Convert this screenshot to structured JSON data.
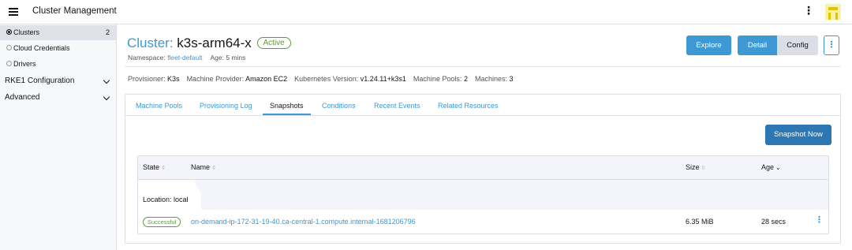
{
  "header": {
    "app_title": "Cluster Management",
    "menu_icon": "hamburger-menu-icon",
    "more_icon": "vertical-dots-icon",
    "logo_icon": "rancher-logo"
  },
  "sidebar": {
    "items": [
      {
        "label": "Clusters",
        "count": "2",
        "icon": "cluster-icon",
        "active": true
      },
      {
        "label": "Cloud Credentials",
        "icon": "circle-icon"
      },
      {
        "label": "Drivers",
        "icon": "circle-icon"
      }
    ],
    "groups": [
      {
        "label": "RKE1 Configuration"
      },
      {
        "label": "Advanced"
      }
    ]
  },
  "cluster": {
    "prefix": "Cluster: ",
    "name": "k3s-arm64-x",
    "state": "Active",
    "namespace_label": "Namespace: ",
    "namespace": "fleet-default",
    "age": "Age: 5 mins",
    "provisioner_label": "Provisioner:",
    "provisioner": "K3s",
    "machine_provider_label": "Machine Provider:",
    "machine_provider": "Amazon EC2",
    "k8s_version_label": "Kubernetes Version:",
    "k8s_version": "v1.24.11+k3s1",
    "machine_pools_label": "Machine Pools:",
    "machine_pools": "2",
    "machines_label": "Machines:",
    "machines": "3"
  },
  "actions": {
    "explore": "Explore",
    "detail": "Detail",
    "config": "Config",
    "more": "⋮"
  },
  "tabs": [
    {
      "label": "Machine Pools"
    },
    {
      "label": "Provisioning Log"
    },
    {
      "label": "Snapshots",
      "active": true
    },
    {
      "label": "Conditions"
    },
    {
      "label": "Recent Events"
    },
    {
      "label": "Related Resources"
    }
  ],
  "snapshots": {
    "button": "Snapshot Now",
    "columns": [
      "State",
      "Name",
      "Size",
      "Age"
    ],
    "group_label": "Location: local",
    "rows": [
      {
        "state": "Successful",
        "name": "on-demand-ip-172-31-19-40.ca-central-1.compute.internal-1681206796",
        "size": "6.35 MiB",
        "age": "28 secs"
      }
    ]
  },
  "colors": {
    "accent": "#3d98d3",
    "success": "#5c9a3a"
  }
}
